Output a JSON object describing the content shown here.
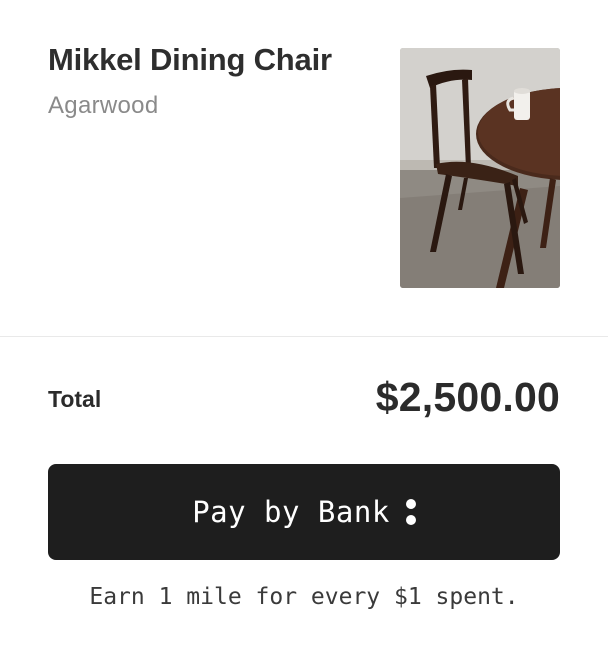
{
  "product": {
    "name": "Mikkel Dining Chair",
    "variant": "Agarwood",
    "image_icon": "chair-photo"
  },
  "summary": {
    "total_label": "Total",
    "total_value": "$2,500.00"
  },
  "payment": {
    "button_label": "Pay by Bank",
    "button_icon": "more-options-icon",
    "note": "Earn 1 mile for every $1 spent."
  },
  "colors": {
    "button_bg": "#1e1e1e",
    "button_text": "#ffffff",
    "variant_text": "#8a8a8a"
  }
}
